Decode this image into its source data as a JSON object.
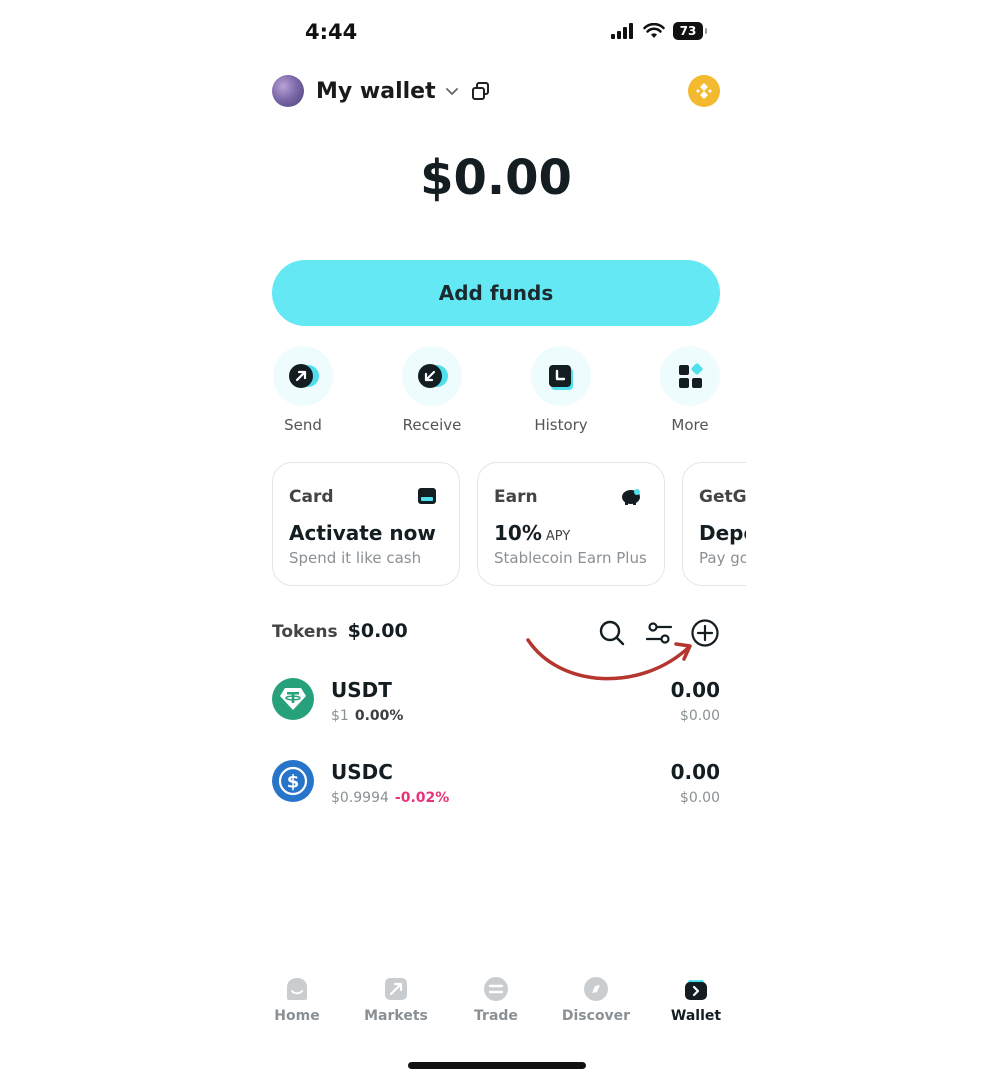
{
  "status_bar": {
    "time": "4:44",
    "battery": "73"
  },
  "header": {
    "wallet_name": "My wallet"
  },
  "balance": "$0.00",
  "add_funds_label": "Add funds",
  "actions": [
    {
      "label": "Send",
      "icon": "send-icon"
    },
    {
      "label": "Receive",
      "icon": "receive-icon"
    },
    {
      "label": "History",
      "icon": "history-icon"
    },
    {
      "label": "More",
      "icon": "more-icon"
    }
  ],
  "cards": [
    {
      "title": "Card",
      "main": "Activate now",
      "sub": "Spend it like cash",
      "icon": "card-icon"
    },
    {
      "title": "Earn",
      "main": "10%",
      "main_suffix": "APY",
      "sub": "Stablecoin Earn Plus",
      "icon": "piggy-bank-icon"
    },
    {
      "title": "GetG",
      "main": "Depo",
      "sub": "Pay go"
    }
  ],
  "tokens": {
    "label": "Tokens",
    "total": "$0.00",
    "items": [
      {
        "symbol": "USDT",
        "price": "$1",
        "change": "0.00%",
        "change_color": "#3a3f42",
        "amount": "0.00",
        "value": "$0.00",
        "icon_color": "#26a17b"
      },
      {
        "symbol": "USDC",
        "price": "$0.9994",
        "change": "-0.02%",
        "change_color": "#e8337a",
        "amount": "0.00",
        "value": "$0.00",
        "icon_color": "#2775ca"
      }
    ]
  },
  "nav": [
    {
      "label": "Home",
      "icon": "home-icon",
      "active": false
    },
    {
      "label": "Markets",
      "icon": "markets-icon",
      "active": false
    },
    {
      "label": "Trade",
      "icon": "trade-icon",
      "active": false
    },
    {
      "label": "Discover",
      "icon": "discover-icon",
      "active": false
    },
    {
      "label": "Wallet",
      "icon": "wallet-icon",
      "active": true
    }
  ],
  "colors": {
    "accent": "#63e8f4",
    "annotation_arrow": "#b5352f"
  }
}
